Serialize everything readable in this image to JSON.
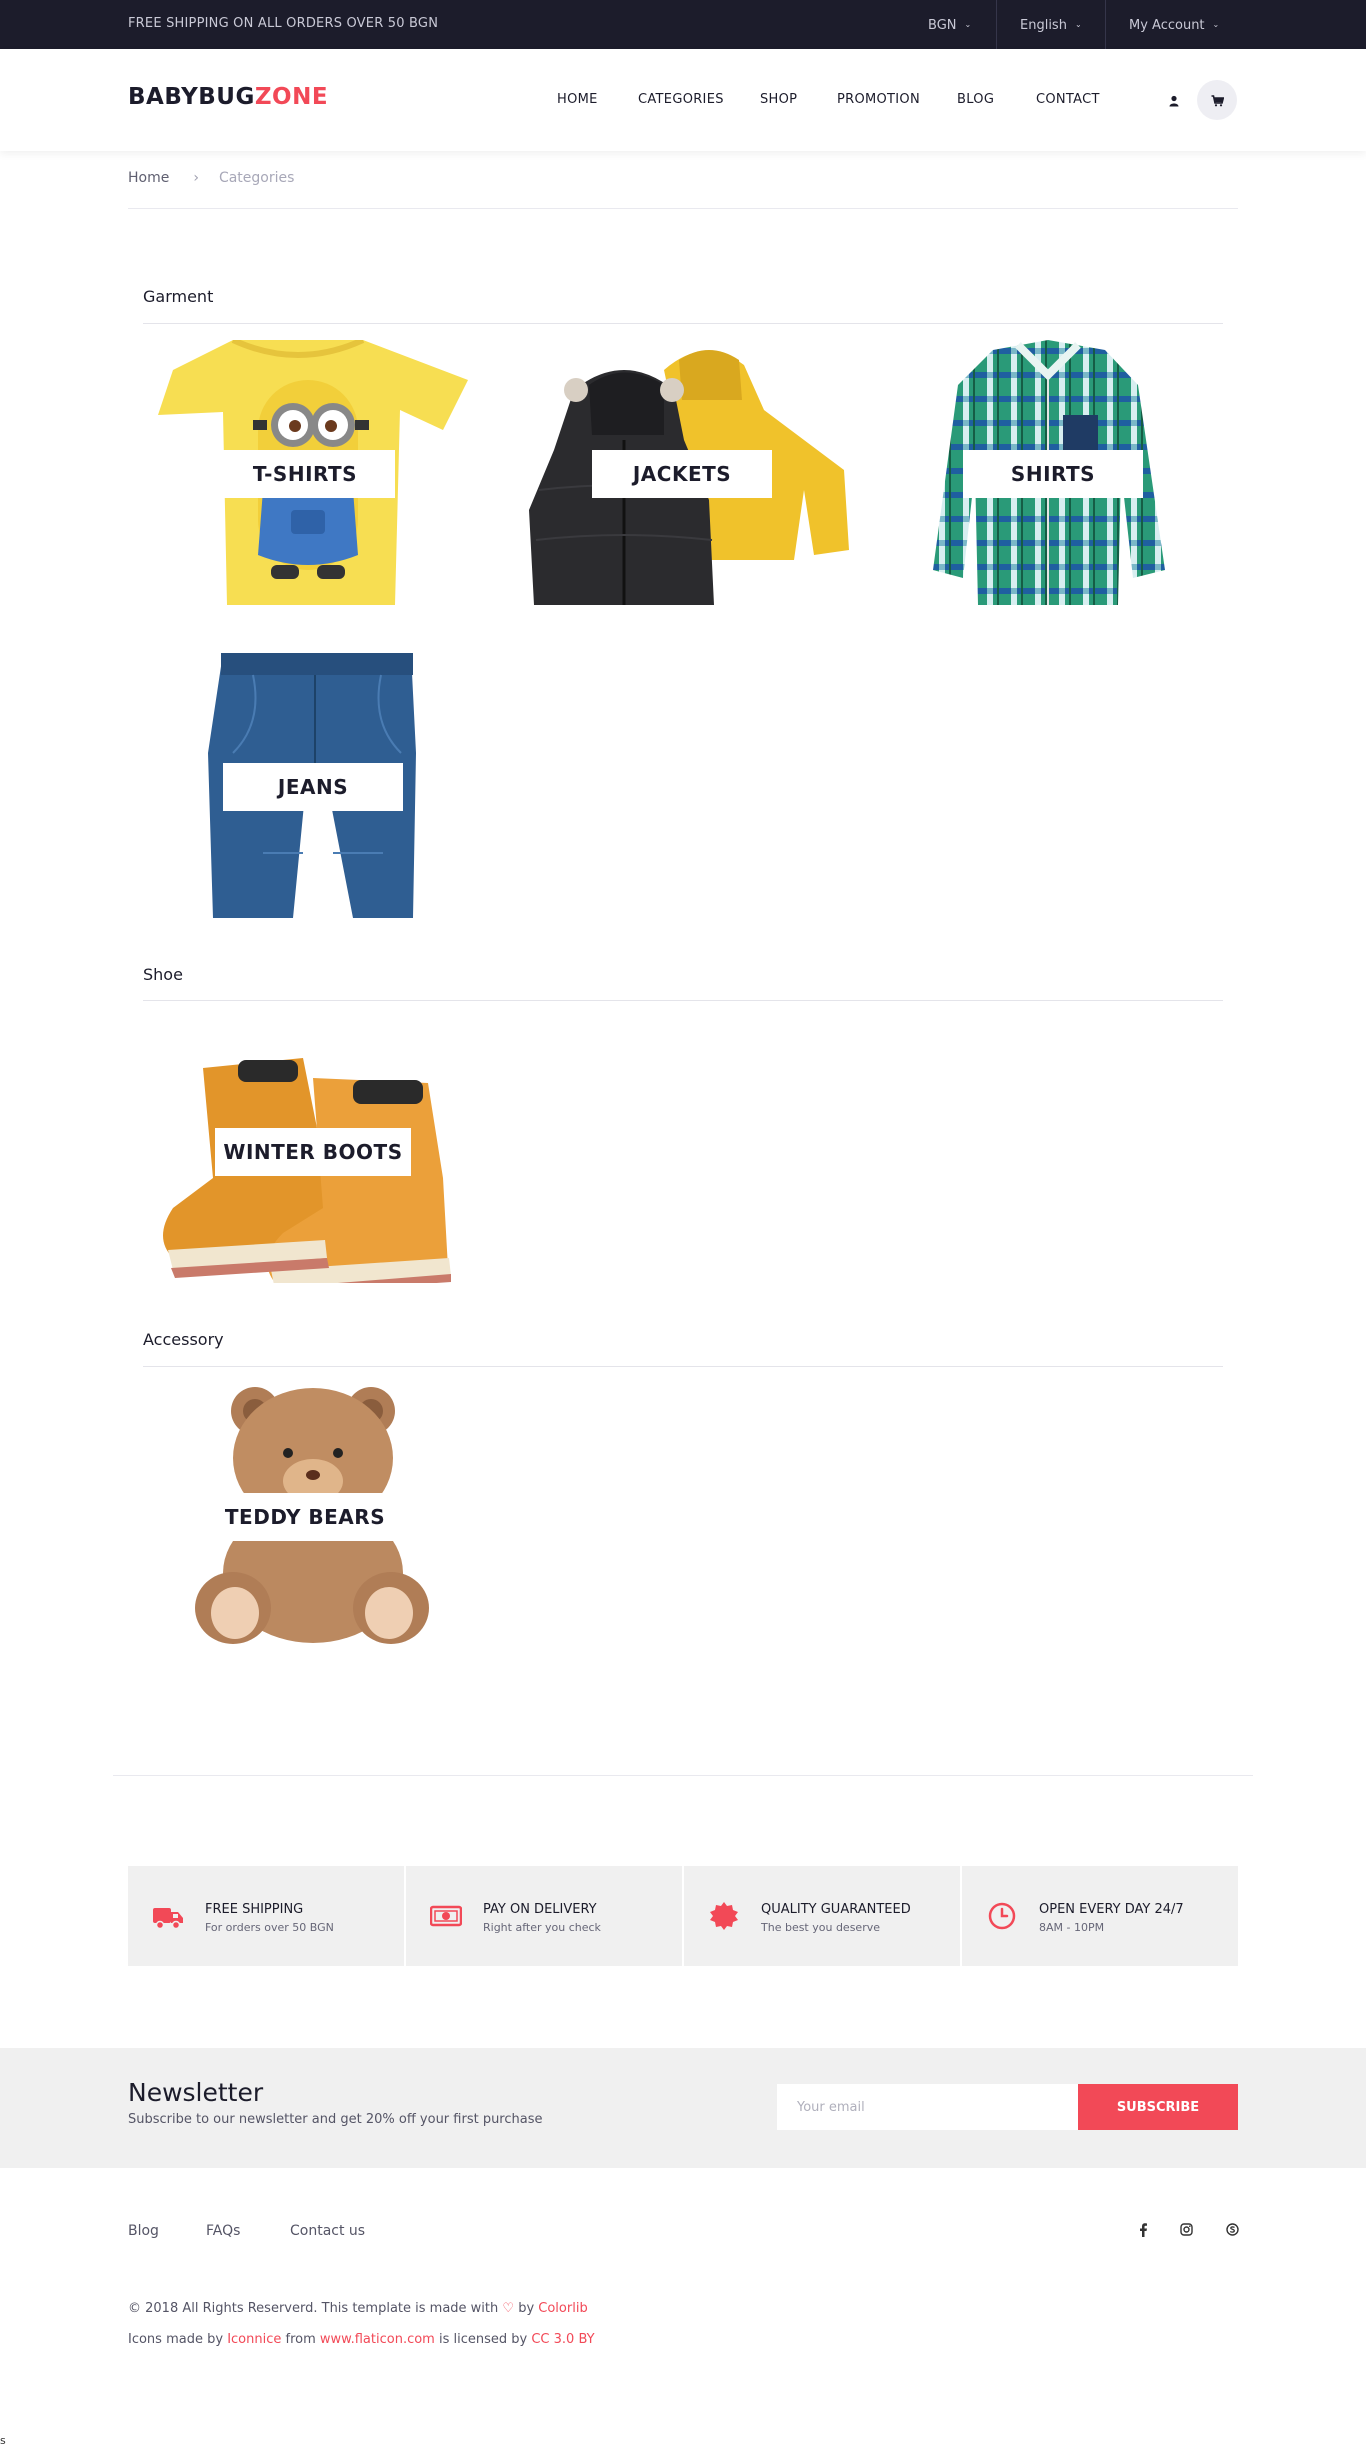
{
  "topbar": {
    "promo": "FREE SHIPPING ON ALL ORDERS OVER 50 BGN",
    "currency": "BGN",
    "language": "English",
    "account": "My Account"
  },
  "header": {
    "logo_main": "BABYBUG",
    "logo_accent": "ZONE",
    "nav": [
      "HOME",
      "CATEGORIES",
      "SHOP",
      "PROMOTION",
      "BLOG",
      "CONTACT"
    ]
  },
  "breadcrumb": {
    "home": "Home",
    "separator": "›",
    "current": "Categories"
  },
  "sections": [
    {
      "title": "Garment",
      "items": [
        "T-SHIRTS",
        "JACKETS",
        "SHIRTS",
        "JEANS"
      ]
    },
    {
      "title": "Shoe",
      "items": [
        "WINTER BOOTS"
      ]
    },
    {
      "title": "Accessory",
      "items": [
        "TEDDY BEARS"
      ]
    }
  ],
  "features": [
    {
      "title": "FREE SHIPPING",
      "subtitle": "For orders over 50 BGN",
      "icon": "truck-icon"
    },
    {
      "title": "PAY ON DELIVERY",
      "subtitle": "Right after you check",
      "icon": "money-icon"
    },
    {
      "title": "QUALITY GUARANTEED",
      "subtitle": "The best you deserve",
      "icon": "badge-icon"
    },
    {
      "title": "OPEN EVERY DAY 24/7",
      "subtitle": "8AM - 10PM",
      "icon": "clock-icon"
    }
  ],
  "newsletter": {
    "title": "Newsletter",
    "subtitle": "Subscribe to our newsletter and get 20% off your first purchase",
    "placeholder": "Your email",
    "button": "SUBSCRIBE"
  },
  "footer": {
    "links": [
      "Blog",
      "FAQs",
      "Contact us"
    ],
    "social": [
      "facebook-icon",
      "instagram-icon",
      "skype-icon"
    ],
    "copyright_prefix": "© 2018 All Rights Reserverd. This template is made with",
    "copyright_by": "by",
    "copyright_author": "Colorlib",
    "icons_prefix": "Icons made by",
    "icons_author": "Iconnice",
    "icons_from": "from",
    "icons_site": "www.flaticon.com",
    "icons_licensed": "is licensed by",
    "icons_license": "CC 3.0 BY",
    "stray_char": "s"
  },
  "colors": {
    "accent": "#f24957",
    "dark": "#1c1c2b",
    "panel": "#f0f0f0"
  }
}
